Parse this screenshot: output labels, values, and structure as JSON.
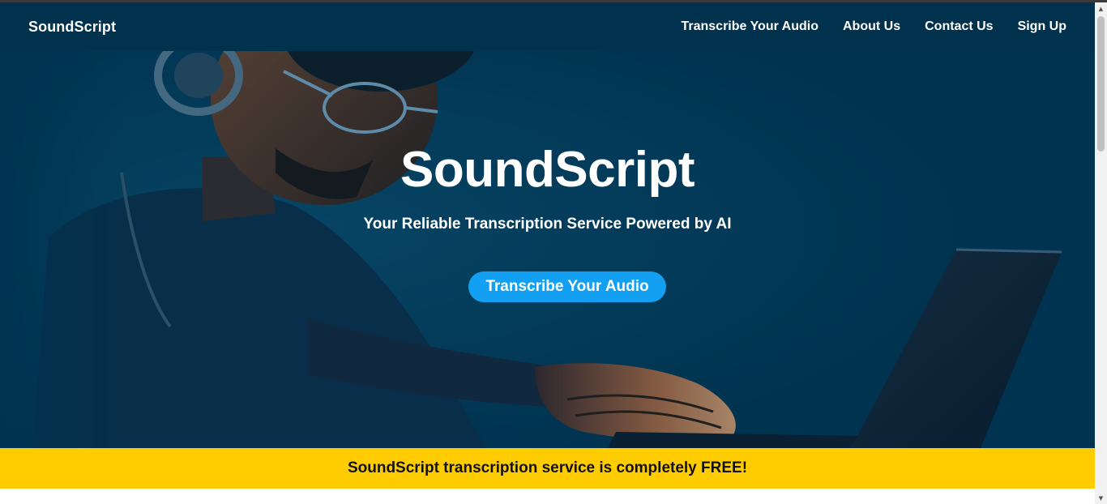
{
  "navbar": {
    "brand": "SoundScript",
    "links": [
      {
        "label": "Transcribe Your Audio"
      },
      {
        "label": "About Us"
      },
      {
        "label": "Contact Us"
      },
      {
        "label": "Sign Up"
      }
    ],
    "background_color": "#00324d"
  },
  "hero": {
    "title": "SoundScript",
    "subtitle": "Your Reliable Transcription Service Powered by AI",
    "cta_label": "Transcribe Your Audio",
    "cta_color": "#13a0f2",
    "background_color": "#003350"
  },
  "banner": {
    "text": "SoundScript transcription service is completely FREE!",
    "background_color": "#ffcc00"
  },
  "icons": [
    "scroll-up-arrow-icon",
    "scroll-down-arrow-icon"
  ]
}
